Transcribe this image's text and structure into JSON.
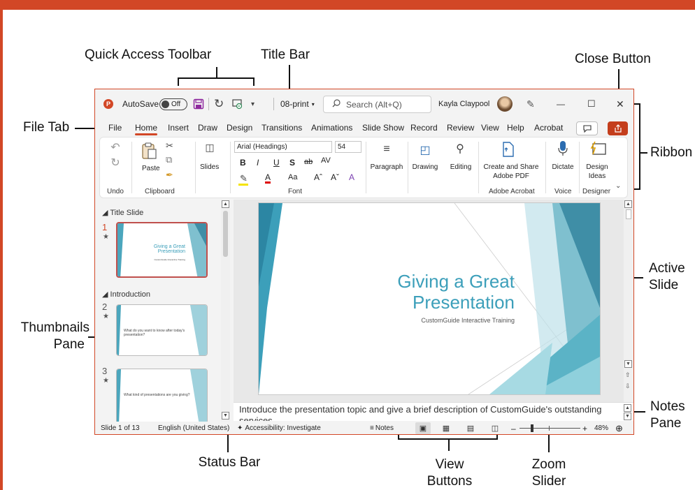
{
  "callouts": {
    "quick_access_toolbar": "Quick Access Toolbar",
    "title_bar": "Title Bar",
    "close_button": "Close Button",
    "file_tab": "File Tab",
    "ribbon": "Ribbon",
    "active_slide_1": "Active",
    "active_slide_2": "Slide",
    "thumbnails_pane_1": "Thumbnails",
    "thumbnails_pane_2": "Pane",
    "notes_pane_1": "Notes",
    "notes_pane_2": "Pane",
    "status_bar": "Status Bar",
    "view_buttons_1": "View",
    "view_buttons_2": "Buttons",
    "zoom_slider_1": "Zoom",
    "zoom_slider_2": "Slider"
  },
  "titlebar": {
    "app_logo": "P",
    "autosave_label": "AutoSave",
    "autosave_state": "Off",
    "filename": "08-print",
    "search_placeholder": "Search (Alt+Q)",
    "user_name": "Kayla Claypool",
    "minimize": "—",
    "restore": "☐",
    "close": "✕"
  },
  "tabs": [
    "File",
    "Home",
    "Insert",
    "Draw",
    "Design",
    "Transitions",
    "Animations",
    "Slide Show",
    "Record",
    "Review",
    "View",
    "Help",
    "Acrobat"
  ],
  "active_tab": "Home",
  "ribbon": {
    "undo_group": "Undo",
    "paste": "Paste",
    "clipboard_group": "Clipboard",
    "slides": "Slides",
    "font_name": "Arial (Headings)",
    "font_size": "54",
    "bold": "B",
    "italic": "I",
    "underline": "U",
    "shadow": "S",
    "strike": "ab",
    "spacing": "AV",
    "case": "Aa",
    "grow": "Aˆ",
    "shrink": "Aˇ",
    "font_group": "Font",
    "paragraph": "Paragraph",
    "drawing": "Drawing",
    "editing": "Editing",
    "create_pdf_1": "Create and Share",
    "create_pdf_2": "Adobe PDF",
    "acrobat_group": "Adobe Acrobat",
    "dictate": "Dictate",
    "voice_group": "Voice",
    "designer_1": "Design",
    "designer_2": "Ideas",
    "designer_group": "Designer"
  },
  "thumbnails": {
    "section1": "Title Slide",
    "section2": "Introduction",
    "slides": [
      {
        "num": "1",
        "text": "Giving a Great Presentation",
        "sub": "CustomGuide Interactive Training"
      },
      {
        "num": "2",
        "text": "What do you want to know after today's presentation?"
      },
      {
        "num": "3",
        "text": "What kind of presentations are you giving?"
      }
    ]
  },
  "slide": {
    "title_line1": "Giving a Great",
    "title_line2": "Presentation",
    "subtitle": "CustomGuide Interactive Training",
    "accent_color": "#3c9fba"
  },
  "notes": {
    "text": "Introduce the presentation topic and give a brief description of CustomGuide's outstanding services."
  },
  "status": {
    "slide_count": "Slide 1 of 13",
    "language": "English (United States)",
    "accessibility": "Accessibility: Investigate",
    "notes_button": "Notes",
    "zoom_out": "–",
    "zoom_in": "+",
    "zoom_level": "48%",
    "zoom_value": 0.48
  }
}
